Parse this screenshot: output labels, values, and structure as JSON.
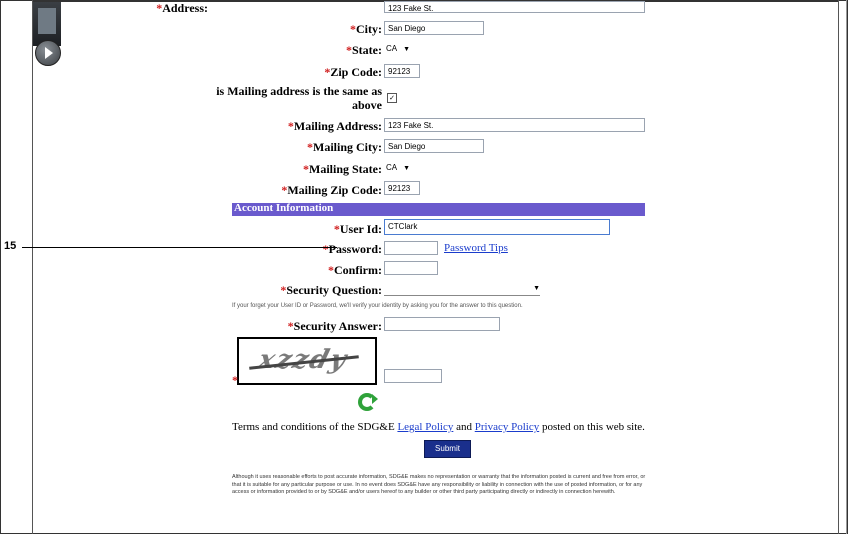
{
  "fields": {
    "address": {
      "label": "Address:",
      "value": "123 Fake St."
    },
    "city": {
      "label": "City:",
      "value": "San Diego"
    },
    "state": {
      "label": "State:",
      "value": "CA"
    },
    "zip": {
      "label": "Zip Code:",
      "value": "92123"
    },
    "same_as_above": {
      "label_line1": "is Mailing address is the same as",
      "label_line2": "above",
      "checked": "✓"
    },
    "mailing_address": {
      "label": "Mailing Address:",
      "value": "123 Fake St."
    },
    "mailing_city": {
      "label": "Mailing City:",
      "value": "San Diego"
    },
    "mailing_state": {
      "label": "Mailing State:",
      "value": "CA"
    },
    "mailing_zip": {
      "label": "Mailing Zip Code:",
      "value": "92123"
    }
  },
  "account": {
    "section_title": "Account Information",
    "user_id": {
      "label": "User Id:",
      "value": "CTClark"
    },
    "password": {
      "label": "Password:",
      "value": "",
      "tips_link": "Password Tips"
    },
    "confirm": {
      "label": "Confirm:",
      "value": ""
    },
    "security_question": {
      "label": "Security Question:",
      "value": ""
    },
    "help_text": "If your forget your User ID or Password, we'll verify your identity by asking you for the answer to this question.",
    "security_answer": {
      "label": "Security Answer:",
      "value": ""
    },
    "captcha_text": "xzzdy",
    "captcha_input": ""
  },
  "required_marker": "*",
  "terms": {
    "prefix": "Terms and conditions of the SDG&E",
    "legal_link": "Legal Policy",
    "and": "and",
    "privacy_link": "Privacy Policy",
    "suffix": "posted on this web site."
  },
  "submit_label": "Submit",
  "disclaimer": "Although it uses reasonable efforts to post accurate information, SDG&E makes no representation or warranty that the information posted is current and free from error, or that it is suitable for any particular purpose or use. In no event does SDG&E have any responsibility or liability in connection with the use of posted information, or for any access or information provided to or by SDG&E and/or users hereof to any builder or other third party participating directly or indirectly in connection herewith.",
  "callout_number": "15",
  "colors": {
    "section_bar": "#6a5acd",
    "required": "#d02020",
    "link": "#1a3ccc",
    "submit": "#1a2f8c"
  },
  "icons": {
    "refresh": "refresh-icon",
    "play": "play-icon"
  }
}
